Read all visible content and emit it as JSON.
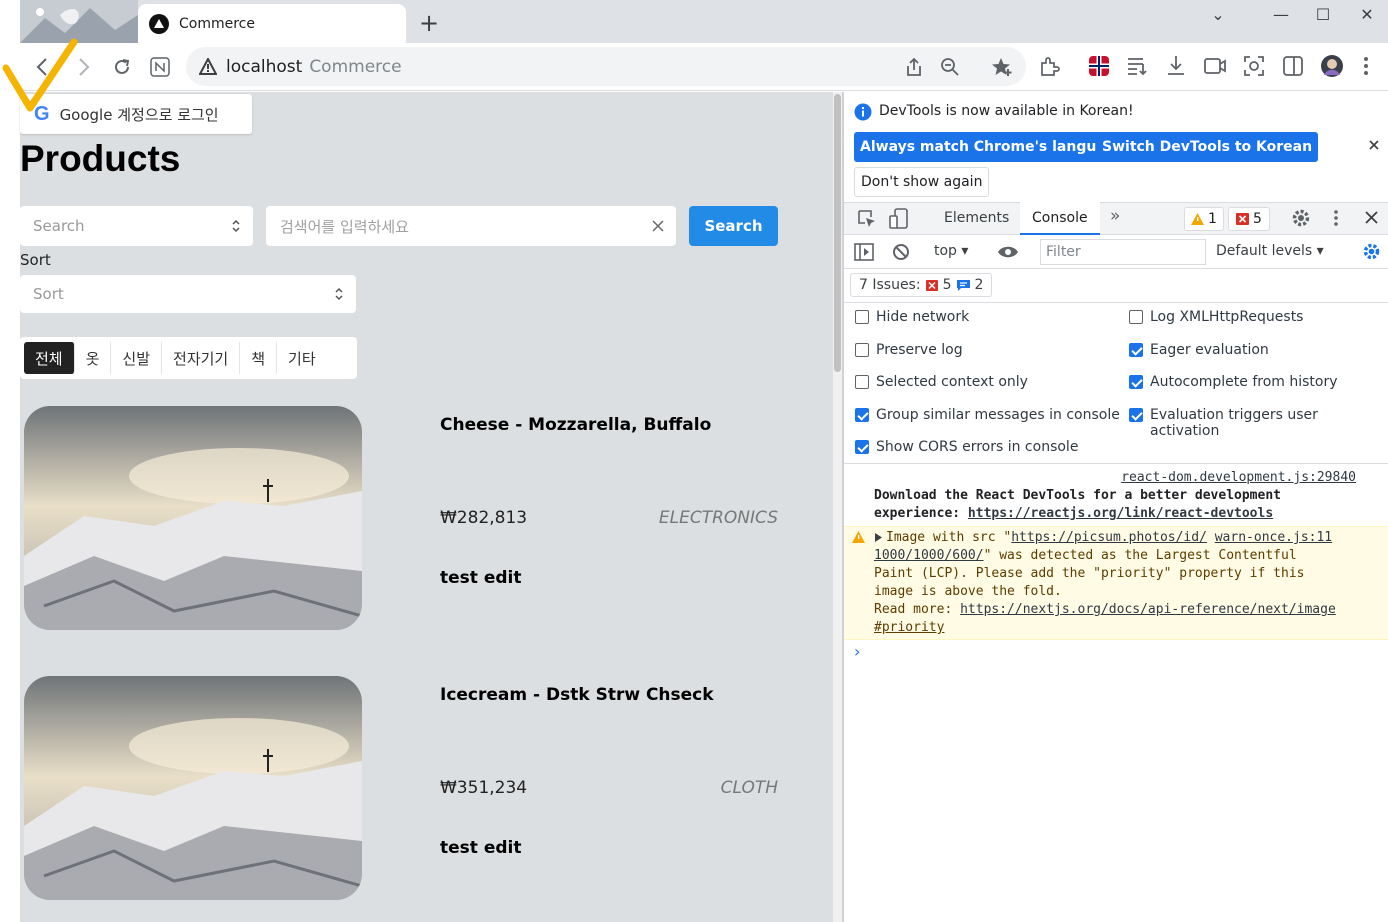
{
  "browser": {
    "tab_title": "Commerce",
    "new_tab": "+",
    "url_host": "localhost",
    "url_title": "Commerce",
    "controls": {
      "chevron": "⌄",
      "minimize": "—",
      "maximize": "☐",
      "close": "✕"
    }
  },
  "page": {
    "google_login": "Google 계정으로 로그인",
    "google_g": "G",
    "heading": "Products",
    "search_select_placeholder": "Search",
    "search_input_placeholder": "검색어를 입력하세요",
    "search_button": "Search",
    "sort_label": "Sort",
    "sort_placeholder": "Sort",
    "categories": [
      "전체",
      "옷",
      "신발",
      "전자기기",
      "책",
      "기타"
    ],
    "active_category": "전체",
    "products": [
      {
        "name": "Cheese - Mozzarella, Buffalo",
        "price": "₩282,813",
        "category": "ELECTRONICS",
        "description": "test edit"
      },
      {
        "name": "Icecream - Dstk Strw Chseck",
        "price": "₩351,234",
        "category": "CLOTH",
        "description": "test edit"
      }
    ]
  },
  "devtools": {
    "banner_text": "DevTools is now available in Korean!",
    "btn_match": "Always match Chrome's language",
    "btn_switch": "Switch DevTools to Korean",
    "btn_dont_show": "Don't show again",
    "tabs": [
      "Elements",
      "Console"
    ],
    "active_tab": "Console",
    "more_tabs": "»",
    "warn_count": "1",
    "error_count": "5",
    "context": "top",
    "filter_placeholder": "Filter",
    "levels": "Default levels",
    "issues_label": "7 Issues:",
    "issues_errors": "5",
    "issues_info": "2",
    "settings_left": [
      {
        "label": "Hide network",
        "checked": false
      },
      {
        "label": "Preserve log",
        "checked": false
      },
      {
        "label": "Selected context only",
        "checked": false
      },
      {
        "label": "Group similar messages in console",
        "checked": true
      },
      {
        "label": "Show CORS errors in console",
        "checked": true
      }
    ],
    "settings_right": [
      {
        "label": "Log XMLHttpRequests",
        "checked": false
      },
      {
        "label": "Eager evaluation",
        "checked": true
      },
      {
        "label": "Autocomplete from history",
        "checked": true
      },
      {
        "label": "Evaluation triggers user activation",
        "checked": true
      }
    ],
    "log1_source": "react-dom.development.js:29840",
    "log1_line1": "Download the React DevTools for a better development",
    "log1_line2_prefix": "experience: ",
    "log1_link": "https://reactjs.org/link/react-devtools",
    "warn_line1_prefix": "Image with src \"",
    "warn_url_part1": "https://picsum.photos/id/",
    "warn_source": "warn-once.js:11",
    "warn_url_part2": "1000/1000/600/",
    "warn_line2_rest": "\" was detected as the Largest Contentful",
    "warn_line3": "Paint (LCP). Please add the \"priority\" property if this",
    "warn_line4": "image is above the fold.",
    "warn_line5_prefix": "Read more: ",
    "warn_link": "https://nextjs.org/docs/api-reference/next/image",
    "warn_link_2": "#priority",
    "prompt": "›"
  },
  "colors": {
    "accent": "#228be6",
    "devtools_blue": "#1a73e8",
    "page_bg": "#dcdfe1",
    "warning_bg": "#fffbe5"
  }
}
